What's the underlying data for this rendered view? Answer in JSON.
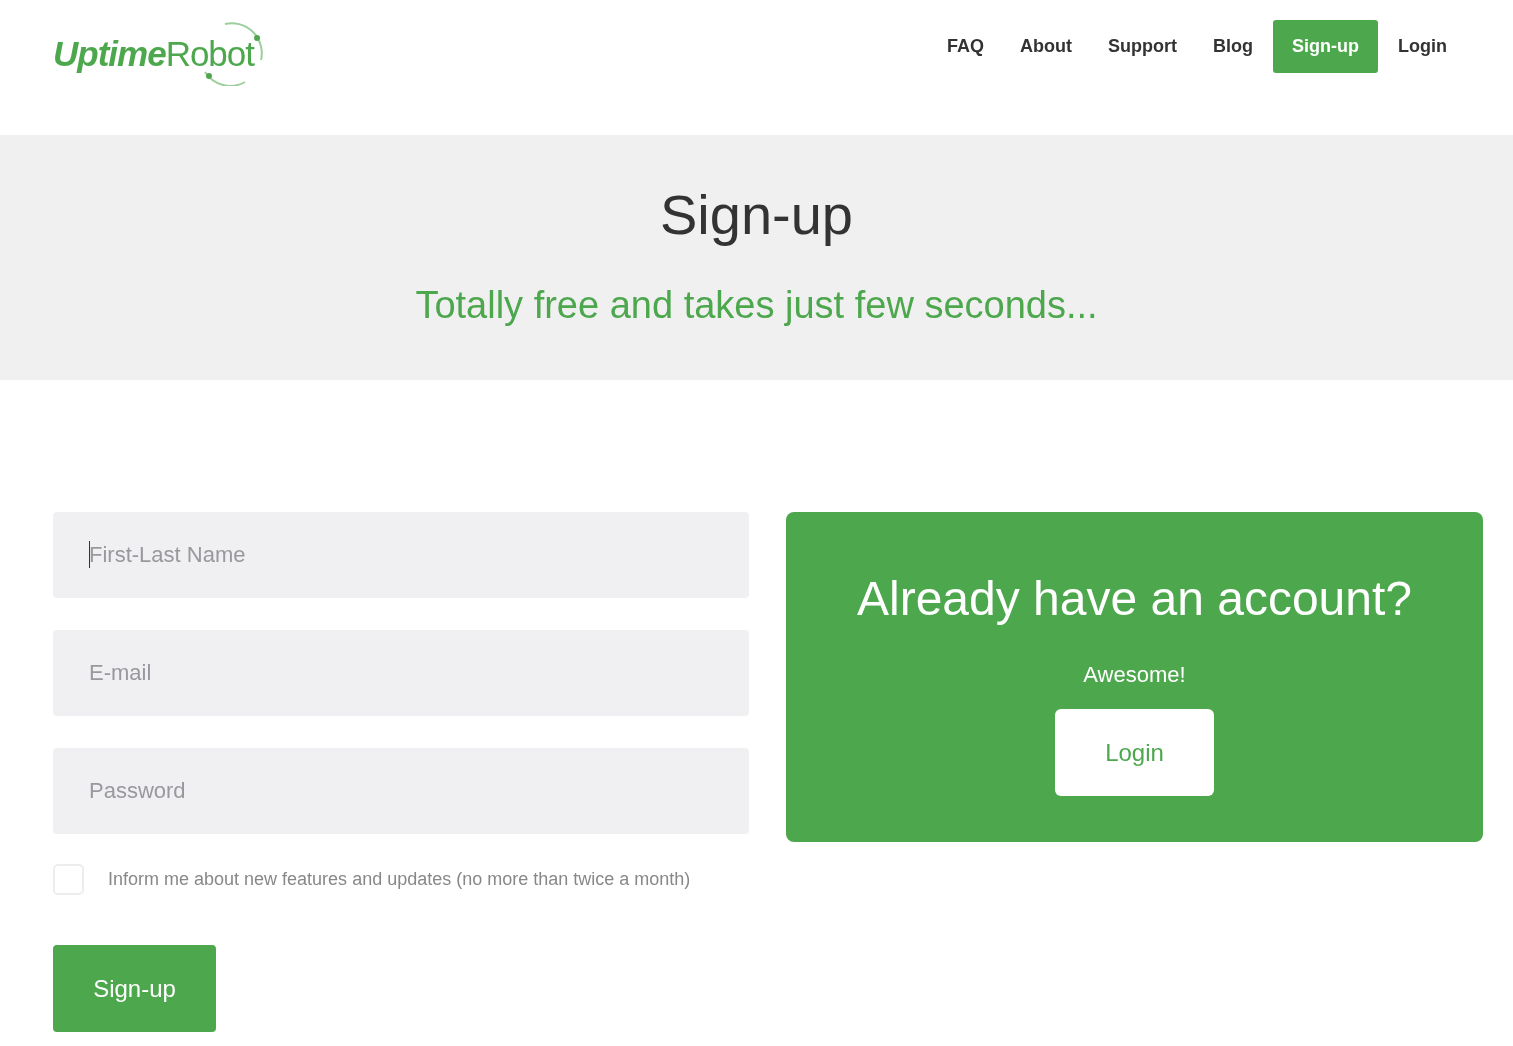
{
  "logo": {
    "bold_part": "Uptime",
    "regular_part": "Robot"
  },
  "nav": [
    {
      "label": "FAQ",
      "selected": false
    },
    {
      "label": "About",
      "selected": false
    },
    {
      "label": "Support",
      "selected": false
    },
    {
      "label": "Blog",
      "selected": false
    },
    {
      "label": "Sign-up",
      "selected": true
    },
    {
      "label": "Login",
      "selected": false
    }
  ],
  "hero": {
    "title": "Sign-up",
    "subtitle": "Totally free and takes just few seconds..."
  },
  "form": {
    "fields": [
      {
        "placeholder": "First-Last Name",
        "focused": true
      },
      {
        "placeholder": "E-mail",
        "focused": false
      },
      {
        "placeholder": "Password",
        "focused": false
      }
    ],
    "newsletter": {
      "label": "Inform me about new features and updates (no more than twice a month)",
      "checked": false
    },
    "submit": "Sign-up"
  },
  "login_card": {
    "title": "Already have an account?",
    "text": "Awesome!",
    "button": "Login"
  }
}
